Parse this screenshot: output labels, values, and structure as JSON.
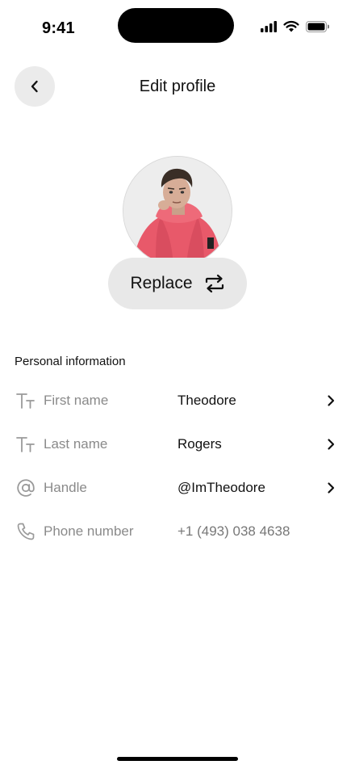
{
  "status_bar": {
    "time": "9:41",
    "icons": [
      "cellular-signal-icon",
      "wifi-icon",
      "battery-icon"
    ]
  },
  "header": {
    "back_icon": "chevron-left-icon",
    "title": "Edit profile"
  },
  "avatar": {
    "description": "profile photo",
    "replace_label": "Replace",
    "replace_icon": "repeat-arrows-icon"
  },
  "section": {
    "title": "Personal information",
    "fields": [
      {
        "icon": "text-size-icon",
        "label": "First name",
        "value": "Theodore",
        "editable": true
      },
      {
        "icon": "text-size-icon",
        "label": "Last name",
        "value": "Rogers",
        "editable": true
      },
      {
        "icon": "at-sign-icon",
        "label": "Handle",
        "value": "@ImTheodore",
        "editable": true
      },
      {
        "icon": "phone-icon",
        "label": "Phone number",
        "value": "+1 (493) 038 4638",
        "editable": false
      }
    ]
  },
  "colors": {
    "background": "#ffffff",
    "button_bg": "#e8e8e8",
    "label_gray": "#8a8a8a",
    "jacket_pink": "#e8596a"
  }
}
